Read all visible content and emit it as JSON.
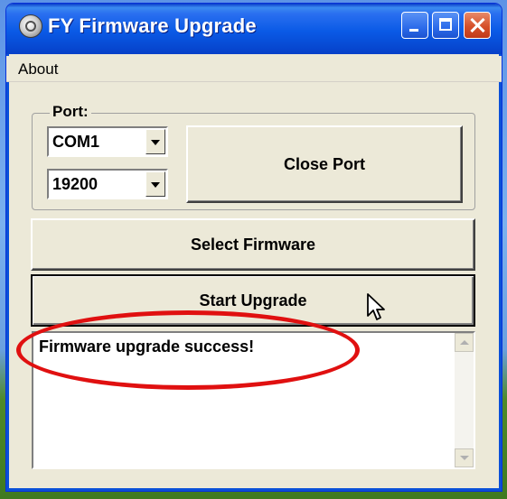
{
  "window": {
    "title": "FY Firmware Upgrade"
  },
  "menu": {
    "items": [
      {
        "label": "About"
      }
    ]
  },
  "port_group": {
    "label": "Port:",
    "port_value": "COM1",
    "baud_value": "19200"
  },
  "buttons": {
    "close_port": "Close Port",
    "select_firmware": "Select Firmware",
    "start_upgrade": "Start Upgrade"
  },
  "log": {
    "text": "Firmware upgrade success!"
  },
  "colors": {
    "title_bar": "#0a5ae6",
    "window_bg": "#ece9d8",
    "highlight": "#e01010"
  },
  "icons": [
    "app-icon",
    "minimize-icon",
    "maximize-icon",
    "close-icon",
    "chevron-down-icon",
    "mouse-cursor-icon"
  ]
}
